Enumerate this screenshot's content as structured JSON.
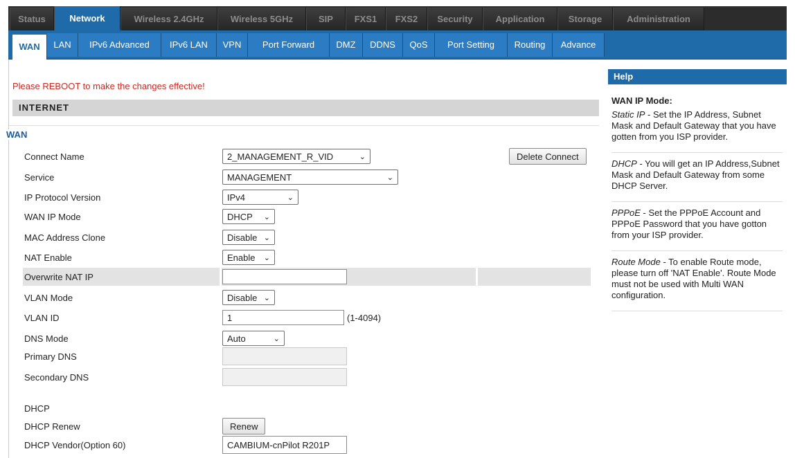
{
  "top_tabs": [
    {
      "label": "Status",
      "active": false
    },
    {
      "label": "Network",
      "active": true
    },
    {
      "label": "Wireless 2.4GHz",
      "active": false
    },
    {
      "label": "Wireless 5GHz",
      "active": false
    },
    {
      "label": "SIP",
      "active": false
    },
    {
      "label": "FXS1",
      "active": false
    },
    {
      "label": "FXS2",
      "active": false
    },
    {
      "label": "Security",
      "active": false
    },
    {
      "label": "Application",
      "active": false
    },
    {
      "label": "Storage",
      "active": false
    },
    {
      "label": "Administration",
      "active": false
    }
  ],
  "sub_tabs": [
    {
      "label": "WAN",
      "active": true
    },
    {
      "label": "LAN",
      "active": false
    },
    {
      "label": "IPv6 Advanced",
      "active": false
    },
    {
      "label": "IPv6 LAN",
      "active": false
    },
    {
      "label": "VPN",
      "active": false
    },
    {
      "label": "Port Forward",
      "active": false
    },
    {
      "label": "DMZ",
      "active": false
    },
    {
      "label": "DDNS",
      "active": false
    },
    {
      "label": "QoS",
      "active": false
    },
    {
      "label": "Port Setting",
      "active": false
    },
    {
      "label": "Routing",
      "active": false
    },
    {
      "label": "Advance",
      "active": false
    }
  ],
  "notice": "Please REBOOT to make the changes effective!",
  "section_title": "INTERNET",
  "fieldset_legend": "WAN",
  "form": {
    "connect_name": {
      "label": "Connect Name",
      "value": "2_MANAGEMENT_R_VID",
      "button": "Delete Connect"
    },
    "service": {
      "label": "Service",
      "value": "MANAGEMENT"
    },
    "ip_protocol_version": {
      "label": "IP Protocol Version",
      "value": "IPv4"
    },
    "wan_ip_mode": {
      "label": "WAN IP Mode",
      "value": "DHCP"
    },
    "mac_address_clone": {
      "label": "MAC Address Clone",
      "value": "Disable"
    },
    "nat_enable": {
      "label": "NAT Enable",
      "value": "Enable"
    },
    "overwrite_nat_ip": {
      "label": "Overwrite NAT IP",
      "value": ""
    },
    "vlan_mode": {
      "label": "VLAN Mode",
      "value": "Disable"
    },
    "vlan_id": {
      "label": "VLAN ID",
      "value": "1",
      "range": "(1-4094)"
    },
    "dns_mode": {
      "label": "DNS Mode",
      "value": "Auto"
    },
    "primary_dns": {
      "label": "Primary DNS",
      "value": ""
    },
    "secondary_dns": {
      "label": "Secondary DNS",
      "value": ""
    },
    "dhcp_heading": "DHCP",
    "dhcp_renew": {
      "label": "DHCP Renew",
      "button": "Renew"
    },
    "dhcp_vendor": {
      "label": "DHCP Vendor(Option 60)",
      "value": "CAMBIUM-cnPilot R201P"
    }
  },
  "help": {
    "title": "Help",
    "heading": "WAN IP Mode:",
    "items": [
      {
        "term": "Static IP",
        "text": " - Set the IP Address, Subnet Mask and Default Gateway that you have gotten from you ISP provider."
      },
      {
        "term": "DHCP",
        "text": " - You will get an IP Address,Subnet Mask and Default Gateway from some DHCP Server."
      },
      {
        "term": "PPPoE",
        "text": " - Set the PPPoE Account and PPPoE Password that you have gotton from your ISP provider."
      },
      {
        "term": "Route Mode",
        "text": " - To enable Route mode, please turn off 'NAT Enable'. Route Mode must not be used with Multi WAN configuration."
      }
    ]
  },
  "colors": {
    "accent": "#1f6aa8",
    "notice": "#d0261e",
    "topbar": "#2c2c2c",
    "legend": "#1c5b99"
  }
}
